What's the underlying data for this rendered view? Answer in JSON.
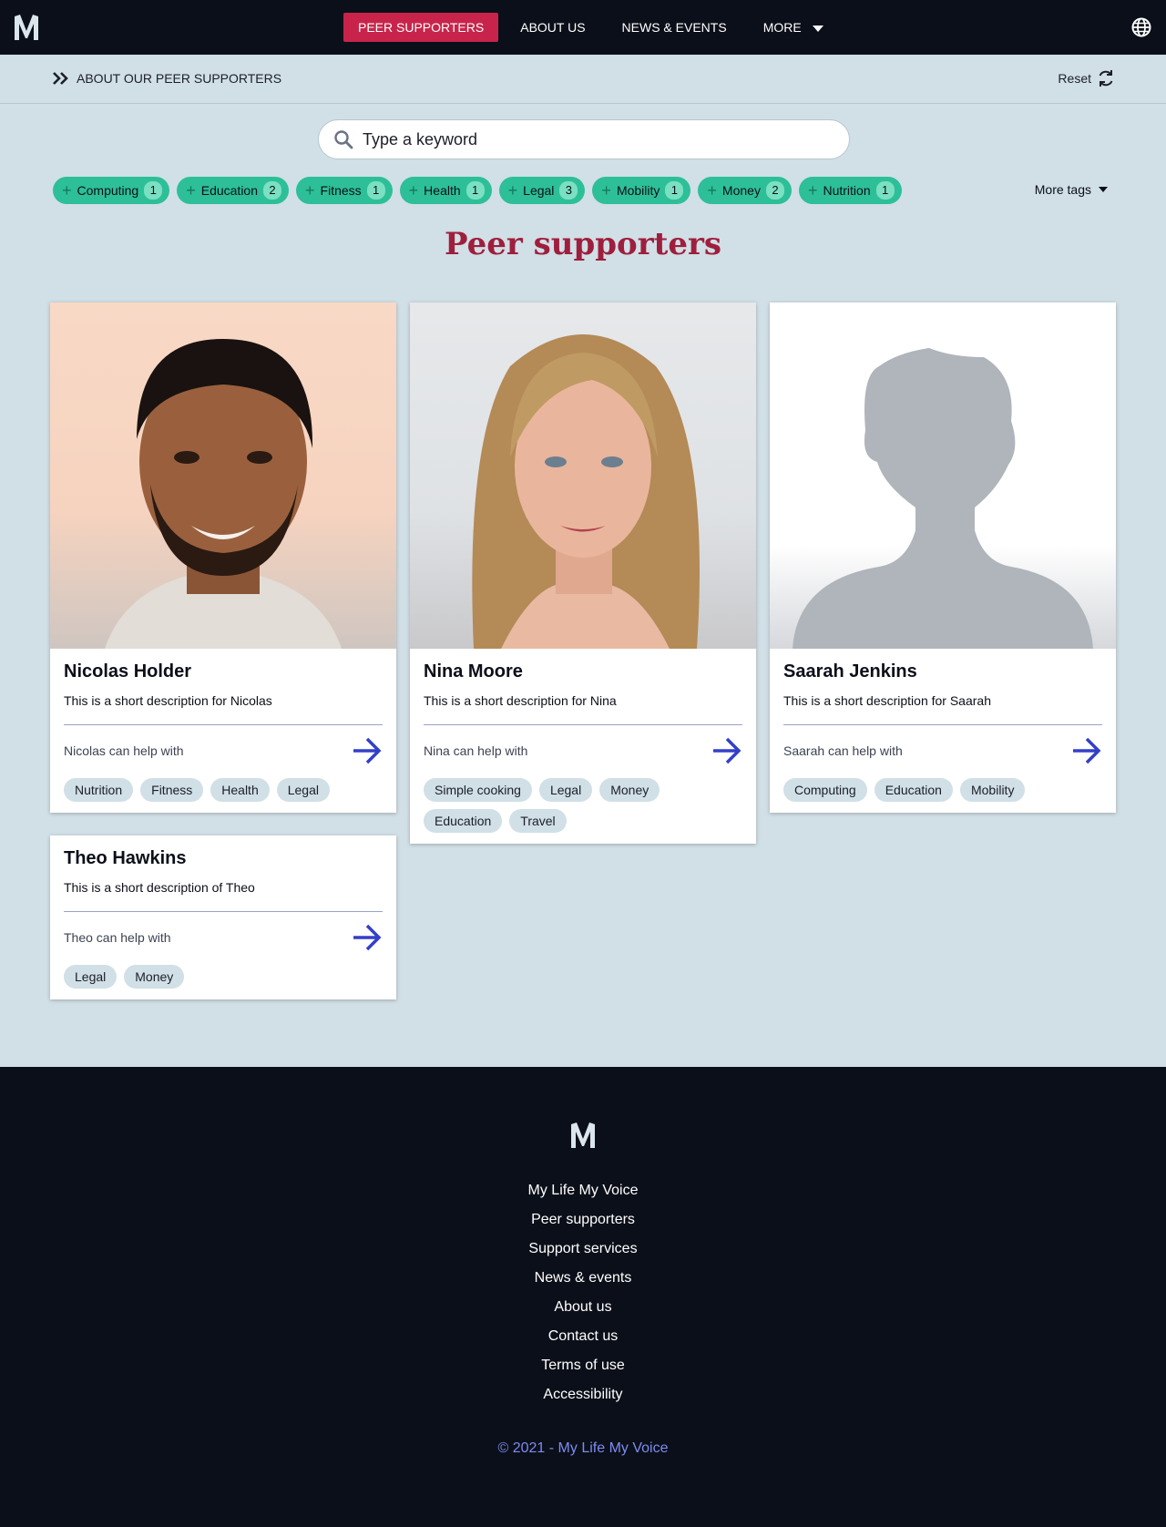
{
  "header": {
    "nav": [
      "PEER SUPPORTERS",
      "ABOUT US",
      "NEWS & EVENTS",
      "MORE"
    ],
    "active_nav": "PEER SUPPORTERS",
    "accent": "#c8244b"
  },
  "subbar": {
    "breadcrumb": "ABOUT OUR PEER SUPPORTERS",
    "reset": "Reset"
  },
  "search": {
    "placeholder": "Type a keyword"
  },
  "tags": [
    {
      "label": "Computing",
      "count": "1"
    },
    {
      "label": "Education",
      "count": "2"
    },
    {
      "label": "Fitness",
      "count": "1"
    },
    {
      "label": "Health",
      "count": "1"
    },
    {
      "label": "Legal",
      "count": "3"
    },
    {
      "label": "Mobility",
      "count": "1"
    },
    {
      "label": "Money",
      "count": "2"
    },
    {
      "label": "Nutrition",
      "count": "1"
    }
  ],
  "more_tags": "More tags",
  "page_title": "Peer supporters",
  "cards": [
    {
      "name": "Nicolas Holder",
      "description": "This is a short description for Nicolas",
      "help": "Nicolas can help with",
      "tags": [
        "Nutrition",
        "Fitness",
        "Health",
        "Legal"
      ],
      "photo": "man-photo"
    },
    {
      "name": "Nina Moore",
      "description": "This is a short description for Nina",
      "help": "Nina can help with",
      "tags": [
        "Simple cooking",
        "Legal",
        "Money",
        "Education",
        "Travel"
      ],
      "photo": "woman-photo"
    },
    {
      "name": "Saarah Jenkins",
      "description": "This is a short description for Saarah",
      "help": "Saarah can help with",
      "tags": [
        "Computing",
        "Education",
        "Mobility"
      ],
      "photo": "placeholder-silhouette"
    },
    {
      "name": "Theo Hawkins",
      "description": "This is a short description of Theo",
      "help": "Theo can help with",
      "tags": [
        "Legal",
        "Money"
      ]
    }
  ],
  "footer": {
    "links": [
      "My Life My Voice",
      "Peer supporters",
      "Support services",
      "News & events",
      "About us",
      "Contact us",
      "Terms of use",
      "Accessibility"
    ],
    "copyright": "© 2021 - My Life My Voice"
  },
  "colors": {
    "page_bg": "#d1dfe6",
    "nav_bg": "#0b0f19",
    "tag_green": "#2dbf98",
    "title_red": "#9e1f3d",
    "arrow_blue": "#3240c8"
  }
}
